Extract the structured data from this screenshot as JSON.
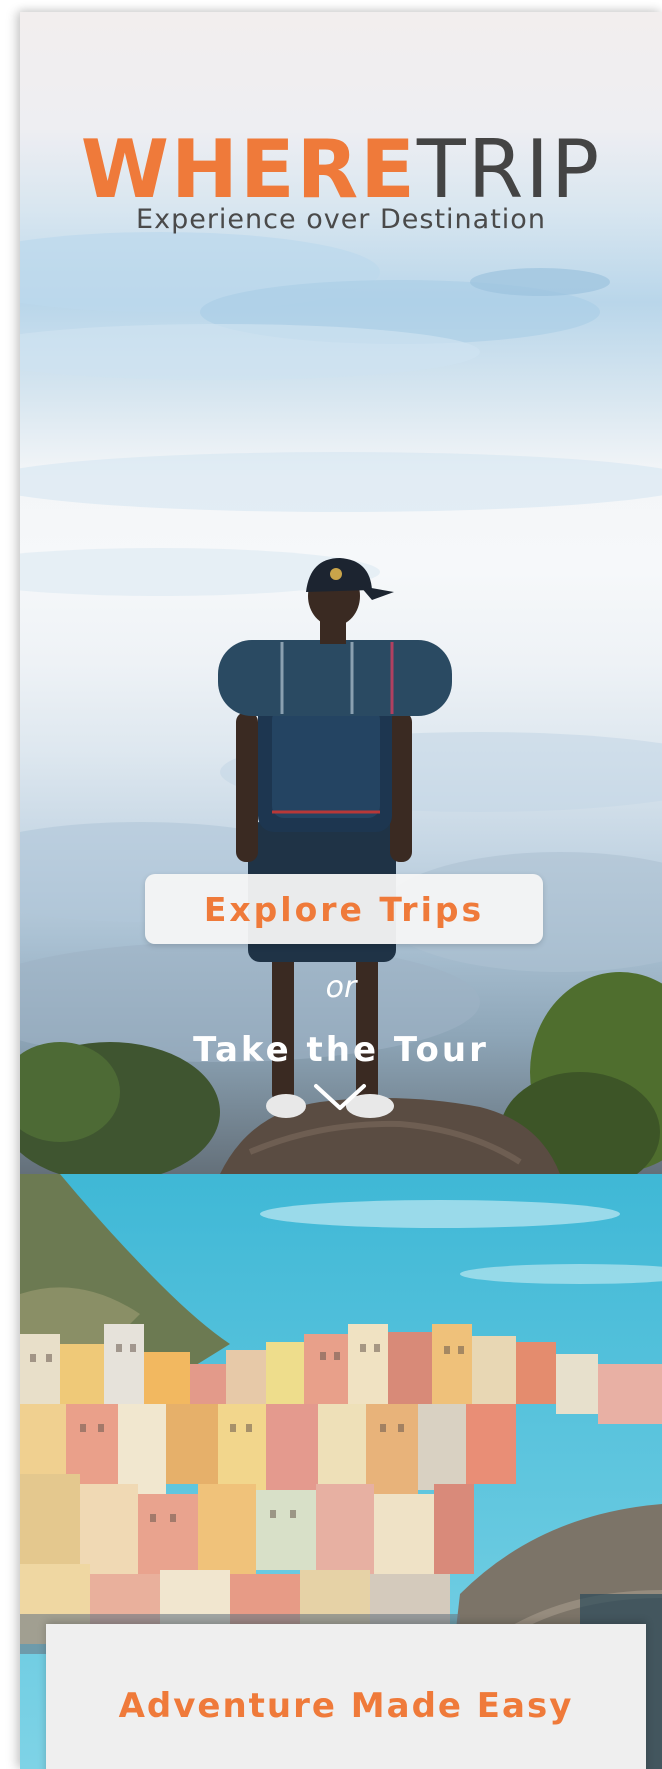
{
  "brand": {
    "name_highlight": "WHERE",
    "name_rest": "TRIP",
    "tagline": "Experience over Destination"
  },
  "hero": {
    "primary_button": "Explore Trips",
    "separator": "or",
    "tour_link": "Take the Tour",
    "scroll_icon": "chevron-down-icon"
  },
  "section": {
    "card_title": "Adventure Made Easy"
  },
  "colors": {
    "accent": "#ef7a3a",
    "brand_dark": "#444444",
    "button_bg": "#f5f5f5",
    "text_light": "#ffffff"
  }
}
